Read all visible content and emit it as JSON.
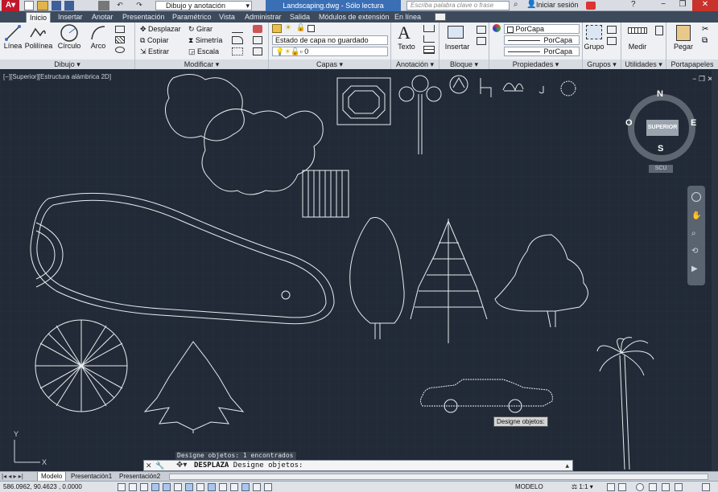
{
  "titlebar": {
    "workspace": "Dibujo y anotación",
    "file_title": "Landscaping.dwg - Sólo lectura",
    "search_placeholder": "Escriba palabra clave o frase",
    "signin": "Iniciar sesión",
    "help": "?"
  },
  "tabs": [
    "Inicio",
    "Insertar",
    "Anotar",
    "Presentación",
    "Paramétrico",
    "Vista",
    "Administrar",
    "Salida",
    "Módulos de extensión",
    "En línea"
  ],
  "ribbon": {
    "dibujo": {
      "title": "Dibujo",
      "linea": "Línea",
      "polilinea": "Polilínea",
      "circulo": "Círculo",
      "arco": "Arco"
    },
    "modificar": {
      "title": "Modificar",
      "desplazar": "Desplazar",
      "girar": "Girar",
      "copiar": "Copiar",
      "simetria": "Simetría",
      "estirar": "Estirar",
      "escala": "Escala"
    },
    "capas": {
      "title": "Capas",
      "state": "Estado de capa no guardado",
      "current": "0"
    },
    "anotacion": {
      "title": "Anotación",
      "texto": "Texto"
    },
    "bloque": {
      "title": "Bloque",
      "insertar": "Insertar"
    },
    "propiedades": {
      "title": "Propiedades",
      "color": "PorCapa",
      "linetype": "PorCapa",
      "lineweight": "PorCapa"
    },
    "grupos": {
      "title": "Grupos",
      "grupo": "Grupo"
    },
    "utilidades": {
      "title": "Utilidades",
      "medir": "Medir"
    },
    "portapapeles": {
      "title": "Portapapeles",
      "pegar": "Pegar"
    }
  },
  "viewport": {
    "label": "[−][Superior][Estructura alámbrica 2D]",
    "viewcube": {
      "top": "SUPERIOR",
      "n": "N",
      "s": "S",
      "e": "E",
      "o": "O",
      "ucs": "SCU"
    },
    "tooltip": "Designe objetos:",
    "ucs_y": "Y",
    "ucs_x": "X"
  },
  "command": {
    "history": "Designe objetos: 1 encontrados",
    "name": "DESPLAZA",
    "prompt": "Designe objetos:"
  },
  "layout_tabs": [
    "Modelo",
    "Presentación1",
    "Presentación2"
  ],
  "status": {
    "coords": "586.0962, 90.4623 , 0.0000",
    "space": "MODELO",
    "scale": "1:1"
  },
  "colors": {
    "bg": "#212a36",
    "ribbon_tab_bar": "#3c4a5c",
    "active_file": "#3a6fb5"
  }
}
